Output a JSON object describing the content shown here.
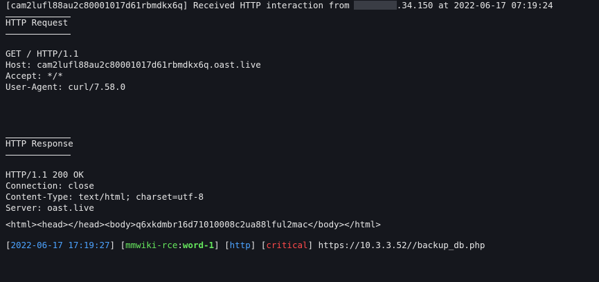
{
  "window": {
    "title": ""
  },
  "header": {
    "id": "[cam2lufl88au2c80001017d61rbmdkx6q]",
    "before_ip": "Received HTTP interaction from",
    "ip_suffix": ".34.150",
    "at_word": "at",
    "timestamp": "2022-06-17 07:19:24"
  },
  "sections": {
    "request_title": "HTTP Request",
    "response_title": "HTTP Response"
  },
  "request": {
    "lines": [
      "GET / HTTP/1.1",
      "Host: cam2lufl88au2c80001017d61rbmdkx6q.oast.live",
      "Accept: */*",
      "User-Agent: curl/7.58.0"
    ]
  },
  "response": {
    "lines": [
      "HTTP/1.1 200 OK",
      "Connection: close",
      "Content-Type: text/html; charset=utf-8",
      "Server: oast.live"
    ],
    "body": "<html><head></head><body>q6xkdmbr16d71010008c2ua88lful2mac</body></html>"
  },
  "result": {
    "timestamp": "2022-06-17 17:19:27",
    "template_name": "mmwiki-rce",
    "matcher": "word-1",
    "protocol": "http",
    "severity": "critical",
    "url": "https://10.3.3.52//backup_db.php",
    "colors": {
      "timestamp": "#4ca3ff",
      "template": "#65e65d",
      "protocol": "#4ca3ff",
      "severity": "#ff4a4a"
    }
  }
}
